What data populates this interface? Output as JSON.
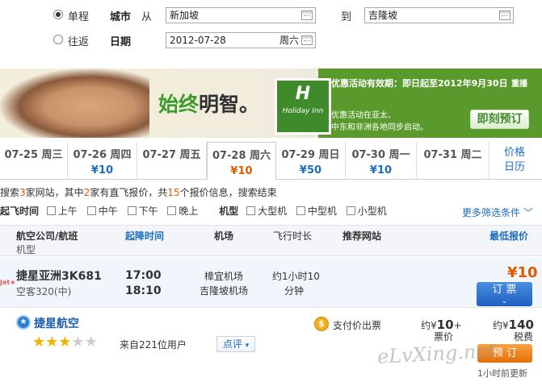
{
  "search": {
    "trip_one_way": "单程",
    "trip_round": "往返",
    "city_label": "城市",
    "from_label": "从",
    "from_value": "新加坡",
    "to_label": "到",
    "to_value": "吉隆坡",
    "date_label": "日期",
    "date_value": "2012-07-28",
    "weekday": "周六"
  },
  "banner": {
    "slogan_green": "始终",
    "slogan_dark": "明智。",
    "brand": "Holiday Inn",
    "promo_line1": "优惠活动有效期：即日起至2012年9月30日",
    "replay": "重播",
    "promo_line2": "优惠活动在亚太、",
    "promo_line3": "中东和非洲各地同步启动。",
    "book_now": "即刻预订"
  },
  "dates": [
    {
      "label": "07-25 周三",
      "price": ""
    },
    {
      "label": "07-26 周四",
      "price": "¥10"
    },
    {
      "label": "07-27 周五",
      "price": ""
    },
    {
      "label": "07-28 周六",
      "price": "¥10"
    },
    {
      "label": "07-29 周日",
      "price": "¥50"
    },
    {
      "label": "07-30 周一",
      "price": "¥10"
    },
    {
      "label": "07-31 周二",
      "price": ""
    }
  ],
  "price_calendar": {
    "line1": "价格",
    "line2": "日历"
  },
  "summary": {
    "p1": "搜索",
    "n1": "3",
    "p2": "家网站，其中",
    "n2": "2",
    "p3": "家有直飞报价，共",
    "n3": "15",
    "p4": "个报价信息，搜索结束"
  },
  "filters": {
    "time_label": "起飞时间",
    "times": [
      "上午",
      "中午",
      "下午",
      "晚上"
    ],
    "type_label": "机型",
    "types": [
      "大型机",
      "中型机",
      "小型机"
    ],
    "more": "更多筛选条件"
  },
  "columns": {
    "airline": "航空公司/航班",
    "model": "机型",
    "times": "起降时间",
    "airport": "机场",
    "duration": "飞行时长",
    "site": "推荐网站",
    "lowest": "最低报价"
  },
  "flight": {
    "airline": "捷星亚洲",
    "number": "3K681",
    "model": "空客320(中)",
    "dep": "17:00",
    "arr": "18:10",
    "dep_airport": "樟宜机场",
    "arr_airport": "吉隆坡机场",
    "duration1": "约1小时10",
    "duration2": "分钟",
    "price": "¥10",
    "book": "订 票",
    "logo": "Jet★"
  },
  "offer": {
    "site": "捷星航空",
    "rating_count": "来自221位用户",
    "comment": "点评",
    "pay": "支付价出票",
    "fare_prefix": "约¥",
    "fare": "10",
    "plus": "+",
    "fare_label": "票价",
    "tax_prefix": "约¥",
    "tax": "140",
    "tax_label": "税费",
    "book": "预 订",
    "updated": "1小时前更新",
    "stars_on": 3,
    "stars_total": 5
  },
  "watermark": "eLvXing.net"
}
